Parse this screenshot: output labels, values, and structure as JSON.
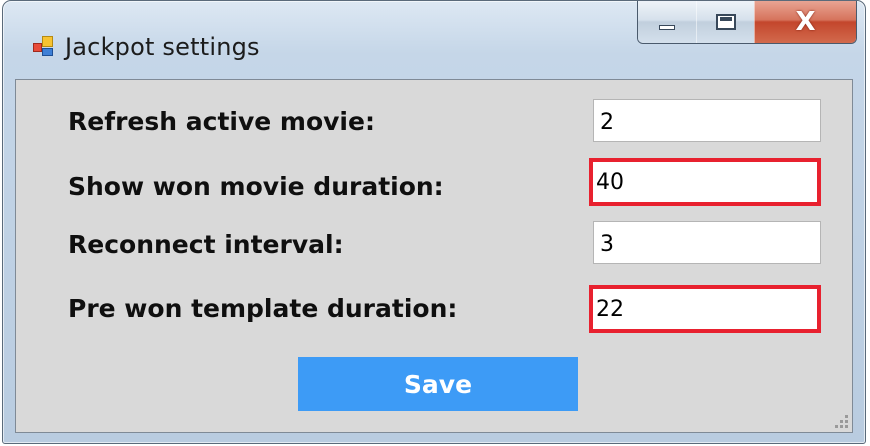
{
  "window": {
    "title": "Jackpot settings",
    "controls": {
      "minimize": "minimize",
      "maximize": "maximize",
      "close": "close"
    }
  },
  "form": {
    "fields": [
      {
        "label": "Refresh active movie:",
        "value": "2",
        "highlighted": false
      },
      {
        "label": "Show won movie duration:",
        "value": "40",
        "highlighted": true
      },
      {
        "label": "Reconnect interval:",
        "value": "3",
        "highlighted": false
      },
      {
        "label": "Pre won template duration:",
        "value": "22",
        "highlighted": true
      }
    ],
    "save_label": "Save"
  },
  "colors": {
    "highlight_border": "#e8212f",
    "save_button": "#3d9bf6",
    "client_background": "#d9d9d9"
  },
  "icons": [
    "app-icon",
    "minimize-icon",
    "maximize-icon",
    "close-icon",
    "resize-grip-icon"
  ]
}
